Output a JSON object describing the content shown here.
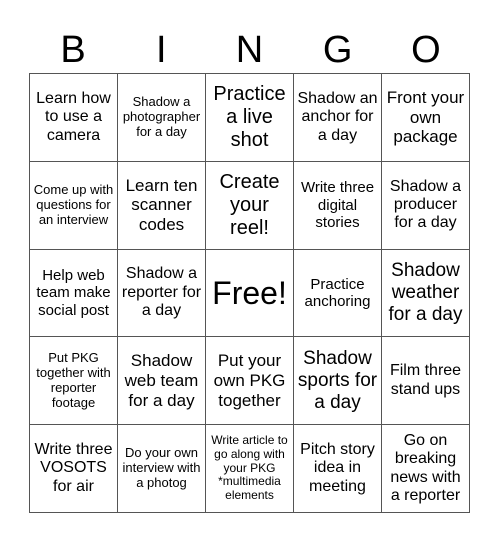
{
  "header": [
    "B",
    "I",
    "N",
    "G",
    "O"
  ],
  "cells": [
    [
      "Learn how to use a camera",
      "Shadow a photographer for a day",
      "Practice a live shot",
      "Shadow an anchor for a day",
      "Front your own package"
    ],
    [
      "Come up with questions for an interview",
      "Learn ten scanner codes",
      "Create your reel!",
      "Write three digital stories",
      "Shadow a producer for a day"
    ],
    [
      "Help web team make social post",
      "Shadow a reporter for a day",
      "Free!",
      "Practice anchoring",
      "Shadow weather for a day"
    ],
    [
      "Put PKG together with reporter footage",
      "Shadow web team for a day",
      "Put your own PKG together",
      "Shadow sports for a day",
      "Film three stand ups"
    ],
    [
      "Write three VOSOTS for air",
      "Do your own interview with a photog",
      "Write article to go along with your PKG *multimedia elements",
      "Pitch story idea in meeting",
      "Go on breaking news with a reporter"
    ]
  ]
}
